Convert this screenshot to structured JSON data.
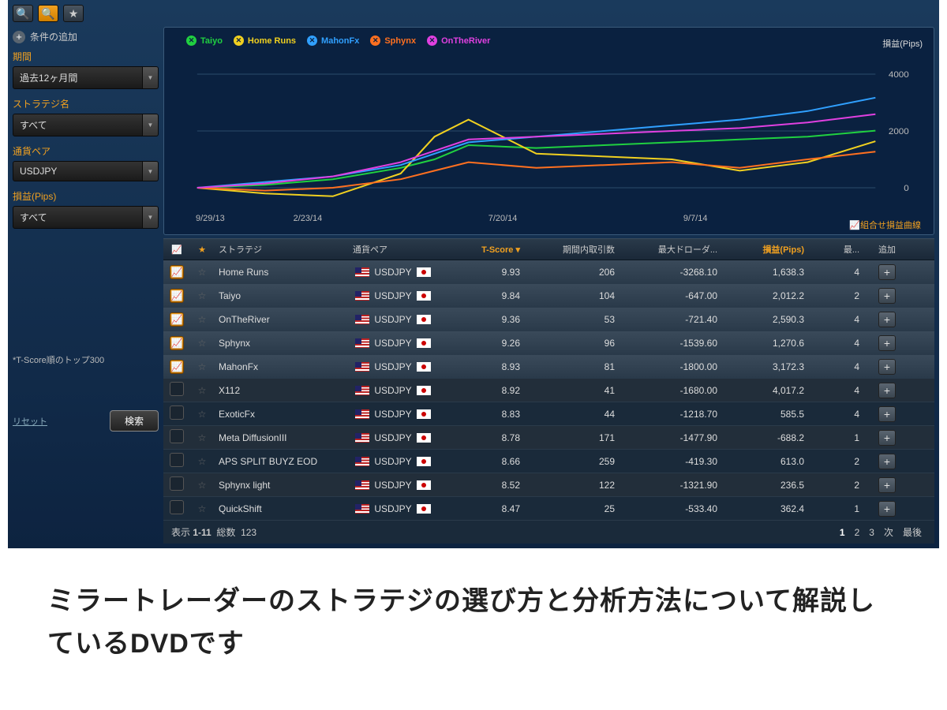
{
  "sidebar": {
    "add_condition": "条件の追加",
    "filters": [
      {
        "label": "期間",
        "value": "過去12ヶ月間"
      },
      {
        "label": "ストラテジ名",
        "value": "すべて"
      },
      {
        "label": "通貨ペア",
        "value": "USDJPY"
      },
      {
        "label": "損益(Pips)",
        "value": "すべて"
      }
    ],
    "note": "*T-Score順のトップ300",
    "reset": "リセット",
    "search": "検索"
  },
  "chart_data": {
    "type": "line",
    "title": "損益(Pips)",
    "x": [
      0,
      0.1,
      0.2,
      0.3,
      0.35,
      0.4,
      0.5,
      0.6,
      0.7,
      0.8,
      0.9,
      1.0
    ],
    "xticks": [
      "9/29/13",
      "2/23/14",
      "7/20/14",
      "9/7/14"
    ],
    "yticks": [
      0,
      2000,
      4000
    ],
    "ylim": [
      -500,
      4500
    ],
    "series": [
      {
        "name": "Taiyo",
        "color": "#20d040",
        "values": [
          0,
          100,
          300,
          700,
          1000,
          1500,
          1400,
          1500,
          1600,
          1700,
          1800,
          2012
        ]
      },
      {
        "name": "Home Runs",
        "color": "#f0d020",
        "values": [
          0,
          -200,
          -300,
          500,
          1800,
          2400,
          1200,
          1100,
          1000,
          600,
          900,
          1638
        ]
      },
      {
        "name": "MahonFx",
        "color": "#30a0ff",
        "values": [
          0,
          200,
          400,
          800,
          1200,
          1600,
          1800,
          2000,
          2200,
          2400,
          2700,
          3172
        ]
      },
      {
        "name": "Sphynx",
        "color": "#ff7020",
        "values": [
          0,
          -100,
          0,
          300,
          600,
          900,
          700,
          800,
          900,
          700,
          1000,
          1270
        ]
      },
      {
        "name": "OnTheRiver",
        "color": "#e040e0",
        "values": [
          0,
          150,
          400,
          900,
          1300,
          1700,
          1800,
          1900,
          2000,
          2100,
          2300,
          2590
        ]
      }
    ],
    "footer": "組合せ損益曲線"
  },
  "table": {
    "headers": {
      "strategy": "ストラテジ",
      "pair": "通貨ペア",
      "tscore": "T-Score",
      "trades": "期間内取引数",
      "drawdown": "最大ドローダ...",
      "pips": "損益(Pips)",
      "max": "最...",
      "add": "追加"
    },
    "rows": [
      {
        "sel": true,
        "name": "Home Runs",
        "pair": "USDJPY",
        "ts": "9.93",
        "tr": "206",
        "dd": "-3268.10",
        "pips": "1,638.3",
        "mx": "4"
      },
      {
        "sel": true,
        "name": "Taiyo",
        "pair": "USDJPY",
        "ts": "9.84",
        "tr": "104",
        "dd": "-647.00",
        "pips": "2,012.2",
        "mx": "2"
      },
      {
        "sel": true,
        "name": "OnTheRiver",
        "pair": "USDJPY",
        "ts": "9.36",
        "tr": "53",
        "dd": "-721.40",
        "pips": "2,590.3",
        "mx": "4"
      },
      {
        "sel": true,
        "name": "Sphynx",
        "pair": "USDJPY",
        "ts": "9.26",
        "tr": "96",
        "dd": "-1539.60",
        "pips": "1,270.6",
        "mx": "4"
      },
      {
        "sel": true,
        "name": "MahonFx",
        "pair": "USDJPY",
        "ts": "8.93",
        "tr": "81",
        "dd": "-1800.00",
        "pips": "3,172.3",
        "mx": "4"
      },
      {
        "sel": false,
        "name": "X112",
        "pair": "USDJPY",
        "ts": "8.92",
        "tr": "41",
        "dd": "-1680.00",
        "pips": "4,017.2",
        "mx": "4"
      },
      {
        "sel": false,
        "name": "ExoticFx",
        "pair": "USDJPY",
        "ts": "8.83",
        "tr": "44",
        "dd": "-1218.70",
        "pips": "585.5",
        "mx": "4"
      },
      {
        "sel": false,
        "name": "Meta DiffusionIII",
        "pair": "USDJPY",
        "ts": "8.78",
        "tr": "171",
        "dd": "-1477.90",
        "pips": "-688.2",
        "mx": "1"
      },
      {
        "sel": false,
        "name": "APS SPLIT BUYZ EOD",
        "pair": "USDJPY",
        "ts": "8.66",
        "tr": "259",
        "dd": "-419.30",
        "pips": "613.0",
        "mx": "2"
      },
      {
        "sel": false,
        "name": "Sphynx light",
        "pair": "USDJPY",
        "ts": "8.52",
        "tr": "122",
        "dd": "-1321.90",
        "pips": "236.5",
        "mx": "2"
      },
      {
        "sel": false,
        "name": "QuickShift",
        "pair": "USDJPY",
        "ts": "8.47",
        "tr": "25",
        "dd": "-533.40",
        "pips": "362.4",
        "mx": "1"
      }
    ],
    "pager": {
      "showing": "表示",
      "range": "1-11",
      "total_label": "総数",
      "total": "123",
      "pages": [
        "1",
        "2",
        "3"
      ],
      "next": "次",
      "last": "最後"
    }
  },
  "caption": "ミラートレーダーのストラテジの選び方と分析方法について解説しているDVDです"
}
